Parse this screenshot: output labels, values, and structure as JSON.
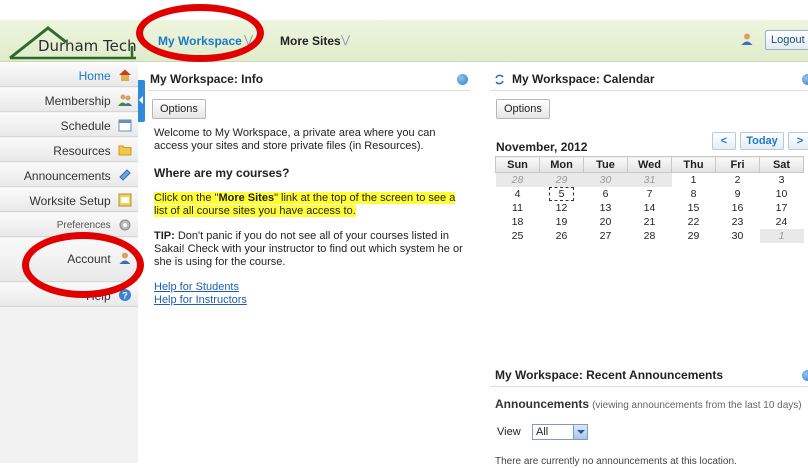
{
  "brand": {
    "name": "Durham Tech"
  },
  "topnav": {
    "my_workspace": "My Workspace",
    "more_sites": "More Sites",
    "logout": "Logout"
  },
  "sidebar": {
    "items": [
      {
        "label": "Home",
        "icon": "home-icon"
      },
      {
        "label": "Membership",
        "icon": "membership-icon"
      },
      {
        "label": "Schedule",
        "icon": "calendar-icon"
      },
      {
        "label": "Resources",
        "icon": "folder-icon"
      },
      {
        "label": "Announcements",
        "icon": "announcements-icon"
      },
      {
        "label": "Worksite Setup",
        "icon": "setup-icon"
      },
      {
        "label": "Preferences",
        "icon": "preferences-icon"
      },
      {
        "label": "Account",
        "icon": "account-icon"
      },
      {
        "label": "Help",
        "icon": "help-icon"
      }
    ]
  },
  "info": {
    "title": "My Workspace: Info",
    "options": "Options",
    "welcome": "Welcome to My Workspace, a private area where you can access your sites and store private files (in Resources).",
    "where_heading": "Where are my courses?",
    "click_pre": "Click on the \"",
    "click_bold": "More Sites",
    "click_post": "\" link at the top of the screen to see a list of all course sites you have access to.",
    "tip_label": "TIP:",
    "tip_text": " Don't panic if you do not see all of your courses listed in Sakai! Check with your instructor to find out which system he or she is using for the course.",
    "help_students": "Help for Students",
    "help_instructors": "Help for Instructors"
  },
  "calendar": {
    "title": "My Workspace: Calendar",
    "options": "Options",
    "month": "November, 2012",
    "prev": "<",
    "today": "Today",
    "next": ">",
    "days": [
      "Sun",
      "Mon",
      "Tue",
      "Wed",
      "Thu",
      "Fri",
      "Sat"
    ],
    "weeks": [
      [
        "28",
        "29",
        "30",
        "31",
        "1",
        "2",
        "3"
      ],
      [
        "4",
        "5",
        "6",
        "7",
        "8",
        "9",
        "10"
      ],
      [
        "11",
        "12",
        "13",
        "14",
        "15",
        "16",
        "17"
      ],
      [
        "18",
        "19",
        "20",
        "21",
        "22",
        "23",
        "24"
      ],
      [
        "25",
        "26",
        "27",
        "28",
        "29",
        "30",
        "1"
      ]
    ],
    "other_month_cells": [
      "0-0",
      "0-1",
      "0-2",
      "0-3",
      "4-6"
    ],
    "today_cell": "1-1"
  },
  "announcements": {
    "title": "My Workspace: Recent Announcements",
    "heading": "Announcements",
    "subheading": "(viewing announcements from the last 10 days)",
    "view_label": "View",
    "view_value": "All",
    "empty": "There are currently no announcements at this location."
  },
  "colors": {
    "accent": "#1a79c7",
    "highlight": "#ffff33",
    "annotation": "#e10000"
  }
}
